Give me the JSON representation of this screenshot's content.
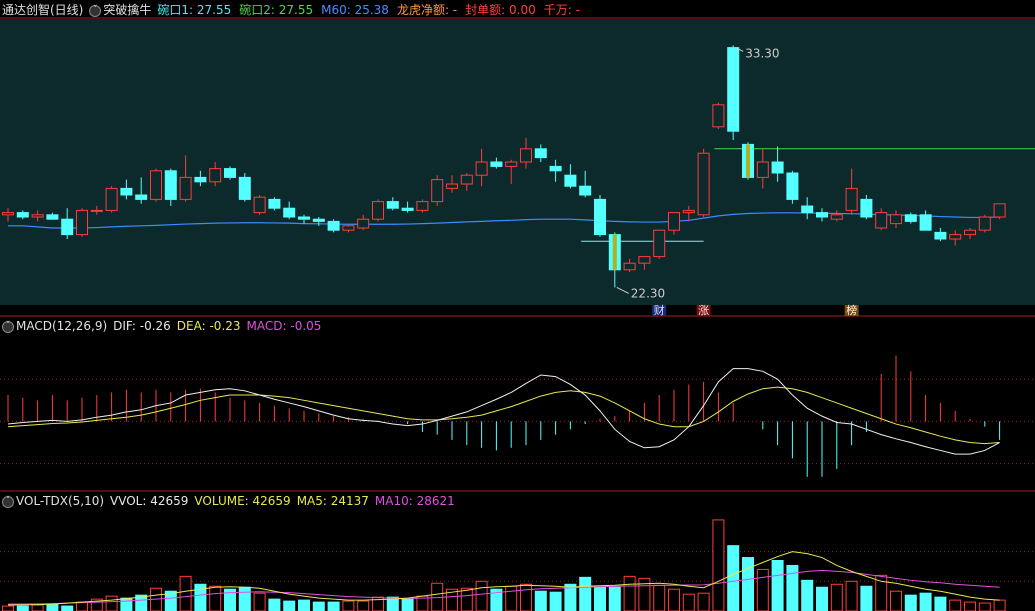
{
  "main_header": {
    "title": "通达创智(日线)",
    "indicator": "突破擒牛",
    "items": [
      {
        "label": "碗口1: 27.55",
        "color": "#4fe8f0"
      },
      {
        "label": "碗口2: 27.55",
        "color": "#4fd64f"
      },
      {
        "label": "M60: 25.38",
        "color": "#4a8cff"
      },
      {
        "label": "龙虎净额: -",
        "color": "#ff9a3a"
      },
      {
        "label": "封单额: 0.00",
        "color": "#ff4040"
      },
      {
        "label": "千万: -",
        "color": "#ff4040"
      }
    ]
  },
  "macd_header": {
    "title": "MACD(12,26,9)",
    "items": [
      {
        "label": "DIF: -0.26",
        "color": "#e8e8e8"
      },
      {
        "label": "DEA: -0.23",
        "color": "#e8e850"
      },
      {
        "label": "MACD: -0.05",
        "color": "#e050e0"
      }
    ]
  },
  "vol_header": {
    "title": "VOL-TDX(5,10)",
    "items": [
      {
        "label": "VVOL: 42659",
        "color": "#e8e8e8"
      },
      {
        "label": "VOLUME: 42659",
        "color": "#e8e850"
      },
      {
        "label": "MA5: 24137",
        "color": "#e8e850"
      },
      {
        "label": "MA10: 28621",
        "color": "#e050e0"
      }
    ]
  },
  "chart_data": [
    {
      "type": "candlestick",
      "ylim": [
        21.5,
        34.5
      ],
      "colors": {
        "up": "#ff3c3c",
        "down": "#54ffff",
        "bg": "#0c2a2c",
        "ma60": "#3a8cff",
        "bowl": "#4fd64f",
        "marker": "#8cff8c"
      },
      "annotations": {
        "high_label": "33.30",
        "low_label": "22.30",
        "markers": [
          "财",
          "涨",
          "榜"
        ]
      },
      "ohlc": [
        [
          25.6,
          25.9,
          25.3,
          25.7
        ],
        [
          25.7,
          25.8,
          25.4,
          25.5
        ],
        [
          25.5,
          25.8,
          25.3,
          25.6
        ],
        [
          25.6,
          25.7,
          25.4,
          25.4
        ],
        [
          25.4,
          25.9,
          24.5,
          24.7
        ],
        [
          24.7,
          25.9,
          24.6,
          25.8
        ],
        [
          25.8,
          26.0,
          25.6,
          25.8
        ],
        [
          25.8,
          26.9,
          25.7,
          26.8
        ],
        [
          26.8,
          27.2,
          26.3,
          26.5
        ],
        [
          26.5,
          27.3,
          26.1,
          26.3
        ],
        [
          26.3,
          27.7,
          26.2,
          27.6
        ],
        [
          27.6,
          27.7,
          26.0,
          26.3
        ],
        [
          26.3,
          28.3,
          26.2,
          27.3
        ],
        [
          27.3,
          27.6,
          26.9,
          27.1
        ],
        [
          27.1,
          28.0,
          26.9,
          27.7
        ],
        [
          27.7,
          27.8,
          27.2,
          27.3
        ],
        [
          27.3,
          27.5,
          26.2,
          26.3
        ],
        [
          25.7,
          26.5,
          25.6,
          26.4
        ],
        [
          26.3,
          26.4,
          25.8,
          25.9
        ],
        [
          25.9,
          26.2,
          25.4,
          25.5
        ],
        [
          25.5,
          25.6,
          25.2,
          25.4
        ],
        [
          25.4,
          25.5,
          25.1,
          25.3
        ],
        [
          25.3,
          25.4,
          24.8,
          24.9
        ],
        [
          24.9,
          25.2,
          24.8,
          25.1
        ],
        [
          25.0,
          25.6,
          24.9,
          25.4
        ],
        [
          25.4,
          26.3,
          25.3,
          26.2
        ],
        [
          26.2,
          26.4,
          25.8,
          25.9
        ],
        [
          25.9,
          26.2,
          25.7,
          25.8
        ],
        [
          25.8,
          26.3,
          25.7,
          26.2
        ],
        [
          26.2,
          27.4,
          26.0,
          27.2
        ],
        [
          26.8,
          27.4,
          26.6,
          27.0
        ],
        [
          27.0,
          27.5,
          26.7,
          27.4
        ],
        [
          27.4,
          28.6,
          26.9,
          28.0
        ],
        [
          28.0,
          28.2,
          27.7,
          27.8
        ],
        [
          27.8,
          28.1,
          27.0,
          28.0
        ],
        [
          28.0,
          29.1,
          27.7,
          28.6
        ],
        [
          28.6,
          28.8,
          28.0,
          28.2
        ],
        [
          27.8,
          28.1,
          27.1,
          27.6
        ],
        [
          27.4,
          27.9,
          26.8,
          26.9
        ],
        [
          26.9,
          27.6,
          26.4,
          26.5
        ],
        [
          26.3,
          26.5,
          24.6,
          24.7
        ],
        [
          24.7,
          24.8,
          22.3,
          23.1
        ],
        [
          23.1,
          23.6,
          23.0,
          23.4
        ],
        [
          23.4,
          23.7,
          23.1,
          23.7
        ],
        [
          23.7,
          24.9,
          23.6,
          24.9
        ],
        [
          24.9,
          25.6,
          24.7,
          25.7
        ],
        [
          25.7,
          26.0,
          25.3,
          25.8
        ],
        [
          25.6,
          28.6,
          25.5,
          28.4
        ],
        [
          29.6,
          30.7,
          29.5,
          30.6
        ],
        [
          33.2,
          33.3,
          29.0,
          29.4
        ],
        [
          28.8,
          28.9,
          27.2,
          27.3
        ],
        [
          27.3,
          28.6,
          26.8,
          28.0
        ],
        [
          28.0,
          28.7,
          27.1,
          27.5
        ],
        [
          27.5,
          27.6,
          26.1,
          26.3
        ],
        [
          26.0,
          26.4,
          25.4,
          25.7
        ],
        [
          25.7,
          25.9,
          25.3,
          25.5
        ],
        [
          25.4,
          25.8,
          25.3,
          25.6
        ],
        [
          25.8,
          27.7,
          25.6,
          26.8
        ],
        [
          26.3,
          26.5,
          25.4,
          25.5
        ],
        [
          25.0,
          25.9,
          24.9,
          25.7
        ],
        [
          25.2,
          25.8,
          25.0,
          25.6
        ],
        [
          25.6,
          25.7,
          25.2,
          25.3
        ],
        [
          25.6,
          25.8,
          25.0,
          24.9
        ],
        [
          24.8,
          25.0,
          24.4,
          24.5
        ],
        [
          24.5,
          24.9,
          24.2,
          24.7
        ],
        [
          24.7,
          25.0,
          24.5,
          24.9
        ],
        [
          24.9,
          25.6,
          24.8,
          25.5
        ],
        [
          25.5,
          26.0,
          25.4,
          26.1
        ]
      ],
      "ma60": [
        25.1,
        25.1,
        25.05,
        25.0,
        25.0,
        25.0,
        25.02,
        25.05,
        25.08,
        25.1,
        25.12,
        25.15,
        25.18,
        25.2,
        25.22,
        25.23,
        25.24,
        25.24,
        25.23,
        25.22,
        25.2,
        25.19,
        25.18,
        25.17,
        25.17,
        25.17,
        25.17,
        25.18,
        25.2,
        25.22,
        25.25,
        25.28,
        25.3,
        25.33,
        25.35,
        25.38,
        25.4,
        25.4,
        25.4,
        25.37,
        25.33,
        25.3,
        25.28,
        25.27,
        25.27,
        25.3,
        25.35,
        25.45,
        25.55,
        25.62,
        25.66,
        25.68,
        25.69,
        25.69,
        25.68,
        25.67,
        25.66,
        25.65,
        25.63,
        25.61,
        25.59,
        25.57,
        25.55,
        25.52,
        25.5,
        25.48,
        25.48,
        25.5
      ],
      "bowl_lines": [
        {
          "from": 39,
          "to": 47,
          "value": 24.4
        },
        {
          "from": 48,
          "to": 67,
          "value": 28.6
        }
      ]
    },
    {
      "type": "macd",
      "ylim": [
        -1.3,
        1.6
      ],
      "dif": [
        -0.05,
        -0.02,
        0.0,
        0.02,
        0.0,
        0.03,
        0.08,
        0.12,
        0.18,
        0.22,
        0.3,
        0.35,
        0.5,
        0.55,
        0.6,
        0.62,
        0.58,
        0.5,
        0.42,
        0.35,
        0.28,
        0.2,
        0.12,
        0.05,
        0.02,
        0.0,
        -0.05,
        -0.08,
        -0.05,
        0.02,
        0.1,
        0.18,
        0.3,
        0.42,
        0.55,
        0.72,
        0.88,
        0.85,
        0.7,
        0.5,
        0.2,
        -0.15,
        -0.38,
        -0.5,
        -0.48,
        -0.35,
        -0.1,
        0.3,
        0.75,
        1.0,
        1.0,
        0.95,
        0.8,
        0.5,
        0.25,
        0.1,
        -0.02,
        -0.05,
        -0.15,
        -0.25,
        -0.33,
        -0.4,
        -0.48,
        -0.55,
        -0.62,
        -0.62,
        -0.55,
        -0.4
      ],
      "dea": [
        -0.1,
        -0.08,
        -0.06,
        -0.04,
        -0.03,
        -0.01,
        0.02,
        0.05,
        0.08,
        0.12,
        0.18,
        0.25,
        0.32,
        0.4,
        0.45,
        0.5,
        0.5,
        0.5,
        0.48,
        0.45,
        0.4,
        0.35,
        0.3,
        0.25,
        0.2,
        0.15,
        0.1,
        0.05,
        0.03,
        0.03,
        0.05,
        0.08,
        0.12,
        0.2,
        0.28,
        0.38,
        0.48,
        0.55,
        0.58,
        0.55,
        0.48,
        0.35,
        0.2,
        0.05,
        -0.05,
        -0.1,
        -0.1,
        0.0,
        0.18,
        0.38,
        0.52,
        0.62,
        0.65,
        0.62,
        0.55,
        0.45,
        0.35,
        0.25,
        0.15,
        0.05,
        -0.05,
        -0.12,
        -0.2,
        -0.28,
        -0.35,
        -0.4,
        -0.42,
        -0.4
      ],
      "hist": [
        0.5,
        0.45,
        0.4,
        0.5,
        0.4,
        0.45,
        0.5,
        0.55,
        0.6,
        0.55,
        0.6,
        0.55,
        0.6,
        0.62,
        0.55,
        0.45,
        0.4,
        0.35,
        0.3,
        0.25,
        0.2,
        0.15,
        0.1,
        0.08,
        0.05,
        0.02,
        0.0,
        -0.05,
        -0.2,
        -0.25,
        -0.35,
        -0.45,
        -0.5,
        -0.55,
        -0.5,
        -0.45,
        -0.35,
        -0.25,
        -0.15,
        -0.05,
        0.05,
        0.1,
        0.2,
        0.35,
        0.5,
        0.6,
        0.7,
        0.75,
        0.55,
        0.35,
        0.0,
        -0.15,
        -0.45,
        -0.7,
        -1.05,
        -1.05,
        -0.9,
        -0.45,
        -0.2,
        0.9,
        1.25,
        0.95,
        0.5,
        0.35,
        0.2,
        0.05,
        -0.1,
        -0.35
      ]
    },
    {
      "type": "volume",
      "ylim": [
        0,
        100000
      ],
      "volume": [
        5000,
        5000,
        6000,
        7000,
        5000,
        9000,
        12000,
        15000,
        13000,
        16000,
        23000,
        20000,
        35000,
        27000,
        25000,
        22000,
        24000,
        18000,
        12000,
        10000,
        11000,
        9000,
        9000,
        10000,
        10000,
        14000,
        14000,
        12000,
        15000,
        28000,
        22000,
        23000,
        30000,
        22000,
        25000,
        27000,
        20000,
        19000,
        27000,
        34000,
        24000,
        24000,
        35000,
        33000,
        26000,
        22000,
        17000,
        18000,
        92000,
        66000,
        54000,
        42000,
        51000,
        46000,
        31000,
        24000,
        27000,
        30000,
        25000,
        36000,
        20000,
        16000,
        18000,
        14000,
        11000,
        9000,
        8000,
        11000
      ],
      "ma5": [
        6000,
        6200,
        6500,
        7000,
        8000,
        9000,
        10000,
        11000,
        12500,
        14000,
        16000,
        17500,
        20000,
        22000,
        24000,
        24500,
        24000,
        23000,
        20000,
        17000,
        15000,
        13000,
        12000,
        11000,
        11000,
        11500,
        12000,
        13000,
        15000,
        17000,
        19000,
        21000,
        23500,
        24500,
        25000,
        26000,
        25500,
        25000,
        24000,
        25000,
        25500,
        26000,
        27000,
        27500,
        28000,
        27000,
        25000,
        23500,
        30000,
        37000,
        43000,
        49000,
        55000,
        60000,
        58000,
        54000,
        46000,
        40000,
        35000,
        30000,
        28000,
        25000,
        22000,
        20000,
        17000,
        14000,
        12000,
        11000
      ],
      "ma10": [
        7000,
        7100,
        7200,
        7500,
        8000,
        8500,
        9000,
        9500,
        10000,
        11000,
        12000,
        13000,
        14500,
        16000,
        17500,
        18500,
        19000,
        19500,
        19000,
        18500,
        17500,
        16500,
        15500,
        14500,
        14000,
        13500,
        13000,
        12800,
        13000,
        13500,
        14500,
        15500,
        17000,
        18500,
        20000,
        21500,
        22500,
        23000,
        23500,
        24000,
        24500,
        25000,
        25200,
        25500,
        25800,
        26000,
        26200,
        26400,
        28000,
        30000,
        32000,
        34000,
        36000,
        38000,
        40000,
        41000,
        40000,
        39000,
        37000,
        35000,
        33000,
        31000,
        29500,
        28500,
        27000,
        26000,
        25000,
        24000
      ]
    }
  ]
}
